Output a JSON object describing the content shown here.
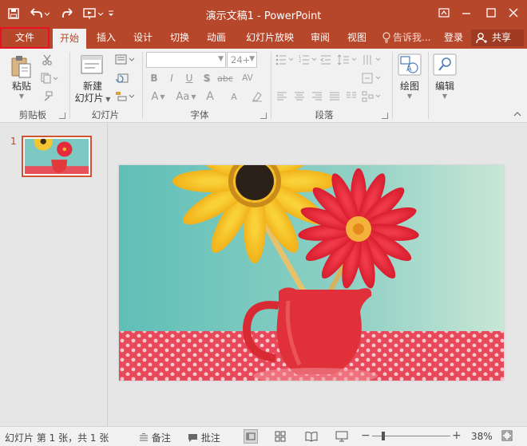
{
  "titlebar": {
    "title": "演示文稿1 - PowerPoint",
    "icons": [
      "save-icon",
      "undo-icon",
      "redo-icon",
      "present-from-start-icon",
      "customize-qat-icon",
      "ribbon-display-options-icon",
      "minimize-icon",
      "maximize-icon",
      "close-icon"
    ]
  },
  "tabs": {
    "file": "文件",
    "home": "开始",
    "insert": "插入",
    "design": "设计",
    "transitions": "切换",
    "animations": "动画",
    "slideshow": "幻灯片放映",
    "review": "审阅",
    "view": "视图",
    "tell_me": "告诉我...",
    "sign_in": "登录",
    "share": "共享"
  },
  "ribbon": {
    "clipboard": {
      "paste": "粘贴",
      "group": "剪贴板"
    },
    "slides": {
      "new_slide_line1": "新建",
      "new_slide_line2": "幻灯片",
      "group": "幻灯片"
    },
    "font": {
      "font_name": "",
      "font_size": "24+",
      "bold": "B",
      "italic": "I",
      "underline": "U",
      "shadow": "S",
      "strike": "abc",
      "spacing": "AV",
      "case": "Aa",
      "color": "A",
      "grow": "A",
      "shrink": "A",
      "group": "字体"
    },
    "paragraph": {
      "group": "段落"
    },
    "drawing": {
      "label": "绘图"
    },
    "editing": {
      "label": "编辑"
    }
  },
  "slides_panel": {
    "slide_number": "1"
  },
  "status": {
    "slide_info": "幻灯片 第 1 张，共 1 张",
    "notes": "备注",
    "comments": "批注",
    "zoom": "38%"
  },
  "colors": {
    "accent": "#b7472a",
    "selection": "#e81123"
  }
}
